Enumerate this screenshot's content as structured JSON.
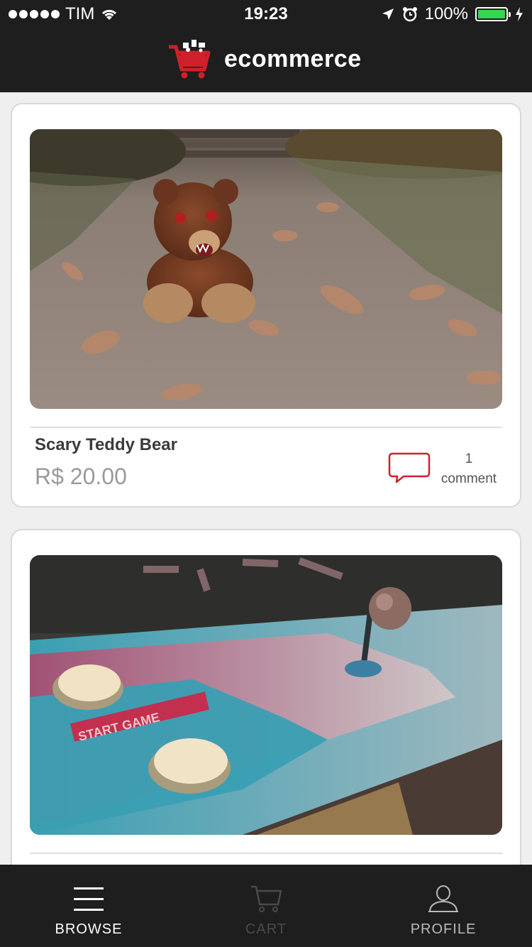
{
  "status_bar": {
    "carrier": "TIM",
    "time": "19:23",
    "battery": "100%",
    "battery_level": 1.0,
    "battery_color": "#35d552"
  },
  "header": {
    "app_name": "ecommerce",
    "logo_icon": "shopping-cart-logo"
  },
  "products": [
    {
      "title": "Scary Teddy Bear",
      "price": "R$ 20.00",
      "comment_count": "1",
      "comment_label": "comment",
      "image": "teddy-bear-photo"
    },
    {
      "title": "",
      "price": "",
      "image": "arcade-cabinet-photo"
    }
  ],
  "tabbar": {
    "items": [
      {
        "label": "BROWSE",
        "icon": "menu-icon",
        "state": "active"
      },
      {
        "label": "CART",
        "icon": "cart-icon",
        "state": "disabled"
      },
      {
        "label": "PROFILE",
        "icon": "user-icon",
        "state": "idle"
      }
    ]
  },
  "colors": {
    "bar_bg": "#1e1e1e",
    "accent_red": "#d0202c",
    "card_border": "#d9d9d9"
  }
}
